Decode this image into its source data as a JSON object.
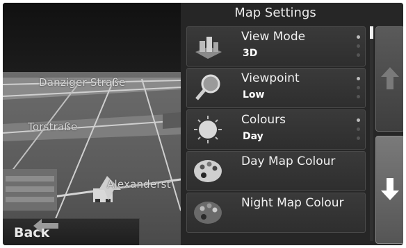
{
  "map": {
    "streets": [
      "Danziger Straße",
      "Torstraße",
      "Alexanderst"
    ],
    "back_label": "Back"
  },
  "panel": {
    "title": "Map Settings",
    "items": [
      {
        "label": "View Mode",
        "value": "3D",
        "icon": "3d-buildings-icon"
      },
      {
        "label": "Viewpoint",
        "value": "Low",
        "icon": "magnifier-icon"
      },
      {
        "label": "Colours",
        "value": "Day",
        "icon": "sun-icon"
      },
      {
        "label": "Day Map Colour",
        "value": "",
        "icon": "palette-icon"
      },
      {
        "label": "Night Map Colour",
        "value": "",
        "icon": "night-palette-icon"
      }
    ]
  },
  "colors": {
    "panel_bg": "#262626",
    "row_bg": "#333333",
    "text": "#f0f0f0"
  }
}
